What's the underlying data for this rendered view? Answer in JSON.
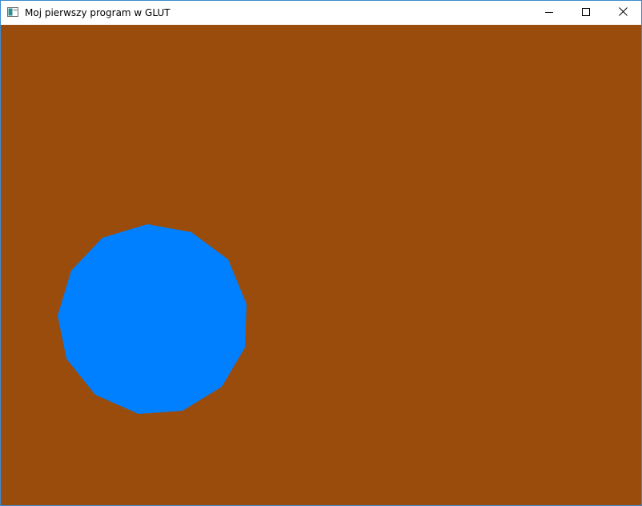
{
  "window": {
    "title": "Moj pierwszy program w GLUT",
    "icon": "app-window-icon",
    "controls": {
      "minimize": "minimize-icon",
      "maximize": "maximize-icon",
      "close": "close-icon"
    }
  },
  "scene": {
    "background_color": "#9a4c0d",
    "shape": "polygon",
    "shape_color": "#0080ff"
  },
  "colors": {
    "window_border": "#3c8ad0"
  }
}
